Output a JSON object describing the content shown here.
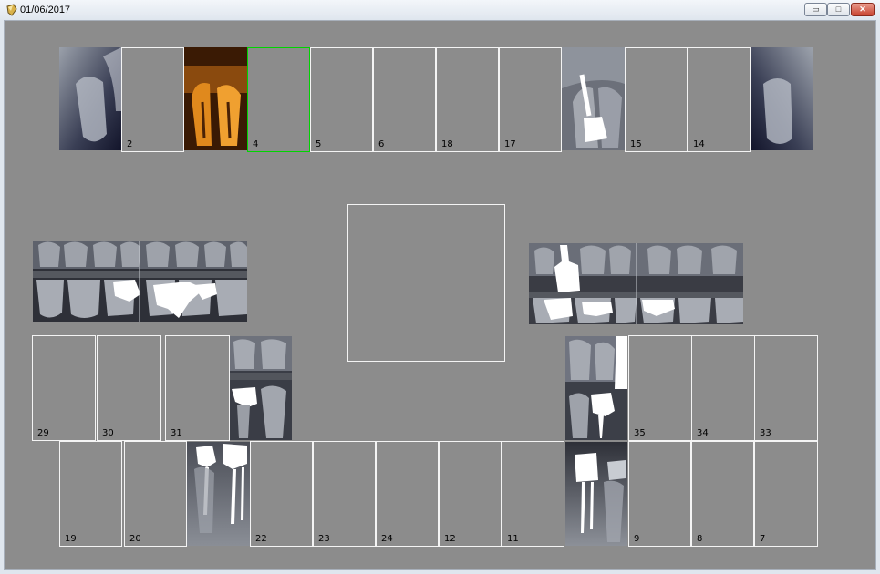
{
  "window": {
    "title": "01/06/2017",
    "minimize_label": "▭",
    "maximize_label": "□",
    "close_label": "✕"
  },
  "slots": {
    "s2": "2",
    "s4": "4",
    "s5": "5",
    "s6": "6",
    "s18": "18",
    "s17": "17",
    "s15": "15",
    "s14": "14",
    "s29": "29",
    "s30": "30",
    "s31": "31",
    "s35": "35",
    "s34": "34",
    "s33": "33",
    "s19": "19",
    "s20": "20",
    "s22": "22",
    "s23": "23",
    "s24": "24",
    "s12": "12",
    "s11": "11",
    "s9": "9",
    "s8": "8",
    "s7": "7"
  },
  "colors": {
    "background": "#8c8c8c",
    "slot_border": "#f4f4f4",
    "selected_border": "#00d400"
  }
}
